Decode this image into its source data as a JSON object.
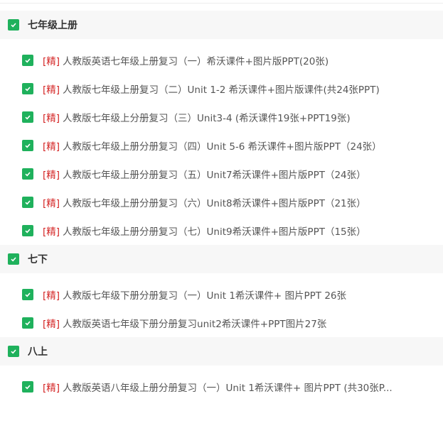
{
  "tag": "[精]",
  "sections": [
    {
      "title": "七年级上册",
      "items": [
        "人教版英语七年级上册复习（一）希沃课件+图片版PPT(20张)",
        "人教版七年级上册复习（二）Unit 1-2 希沃课件+图片版课件(共24张PPT)",
        "人教版七年级上分册复习（三）Unit3-4 (希沃课件19张+PPT19张)",
        "人教版七年级上册分册复习（四）Unit 5-6 希沃课件+图片版PPT（24张）",
        "人教版七年级上册分册复习（五）Unit7希沃课件+图片版PPT（24张）",
        "人教版七年级上册分册复习（六）Unit8希沃课件+图片版PPT（21张）",
        "人教版七年级上册分册复习（七）Unit9希沃课件+图片版PPT（15张）"
      ]
    },
    {
      "title": "七下",
      "items": [
        "人教版七年级下册分册复习（一）Unit 1希沃课件+ 图片PPT 26张",
        "人教版英语七年级下册分册复习unit2希沃课件+PPT图片27张"
      ]
    },
    {
      "title": "八上",
      "items": [
        "人教版英语八年级上册分册复习（一）Unit 1希沃课件+ 图片PPT (共30张P..."
      ]
    }
  ]
}
